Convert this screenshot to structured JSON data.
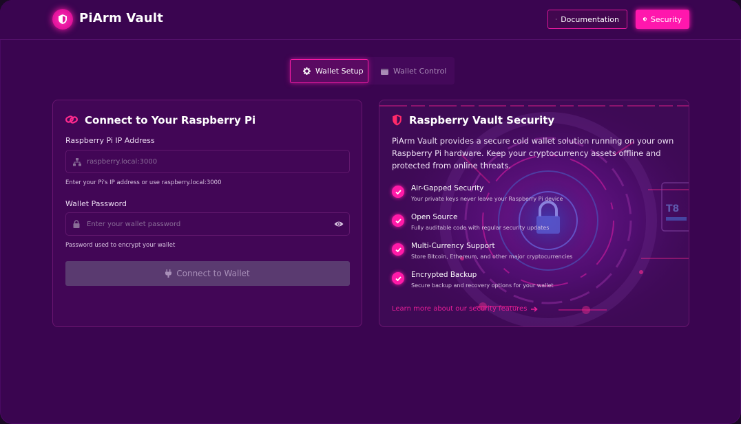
{
  "header": {
    "brand": "PiArm Vault",
    "documentation_label": "Documentation",
    "security_label": "Security"
  },
  "tabs": [
    {
      "label": "Wallet Setup",
      "active": true
    },
    {
      "label": "Wallet Control",
      "active": false
    }
  ],
  "connect_card": {
    "title": "Connect to Your Raspberry Pi",
    "ip_label": "Raspberry Pi IP Address",
    "ip_placeholder": "raspberry.local:3000",
    "ip_hint": "Enter your Pi's IP address or use raspberry.local:3000",
    "password_label": "Wallet Password",
    "password_placeholder": "Enter your wallet password",
    "password_hint": "Password used to encrypt your wallet",
    "connect_label": "Connect to Wallet"
  },
  "security_card": {
    "title": "Raspberry Vault Security",
    "description": "PiArm Vault provides a secure cold wallet solution running on your own Raspberry Pi hardware. Keep your cryptocurrency assets offline and protected from online threats.",
    "features": [
      {
        "title": "Air-Gapped Security",
        "desc": "Your private keys never leave your Raspberry Pi device"
      },
      {
        "title": "Open Source",
        "desc": "Fully auditable code with regular security updates"
      },
      {
        "title": "Multi-Currency Support",
        "desc": "Store Bitcoin, Ethereum, and other major cryptocurrencies"
      },
      {
        "title": "Encrypted Backup",
        "desc": "Secure backup and recovery options for your wallet"
      }
    ],
    "learn_more": "Learn more about our security features",
    "art_text": "T8"
  },
  "colors": {
    "background": "#3a0550",
    "accent": "#ff1aa8",
    "card": "#420656"
  }
}
